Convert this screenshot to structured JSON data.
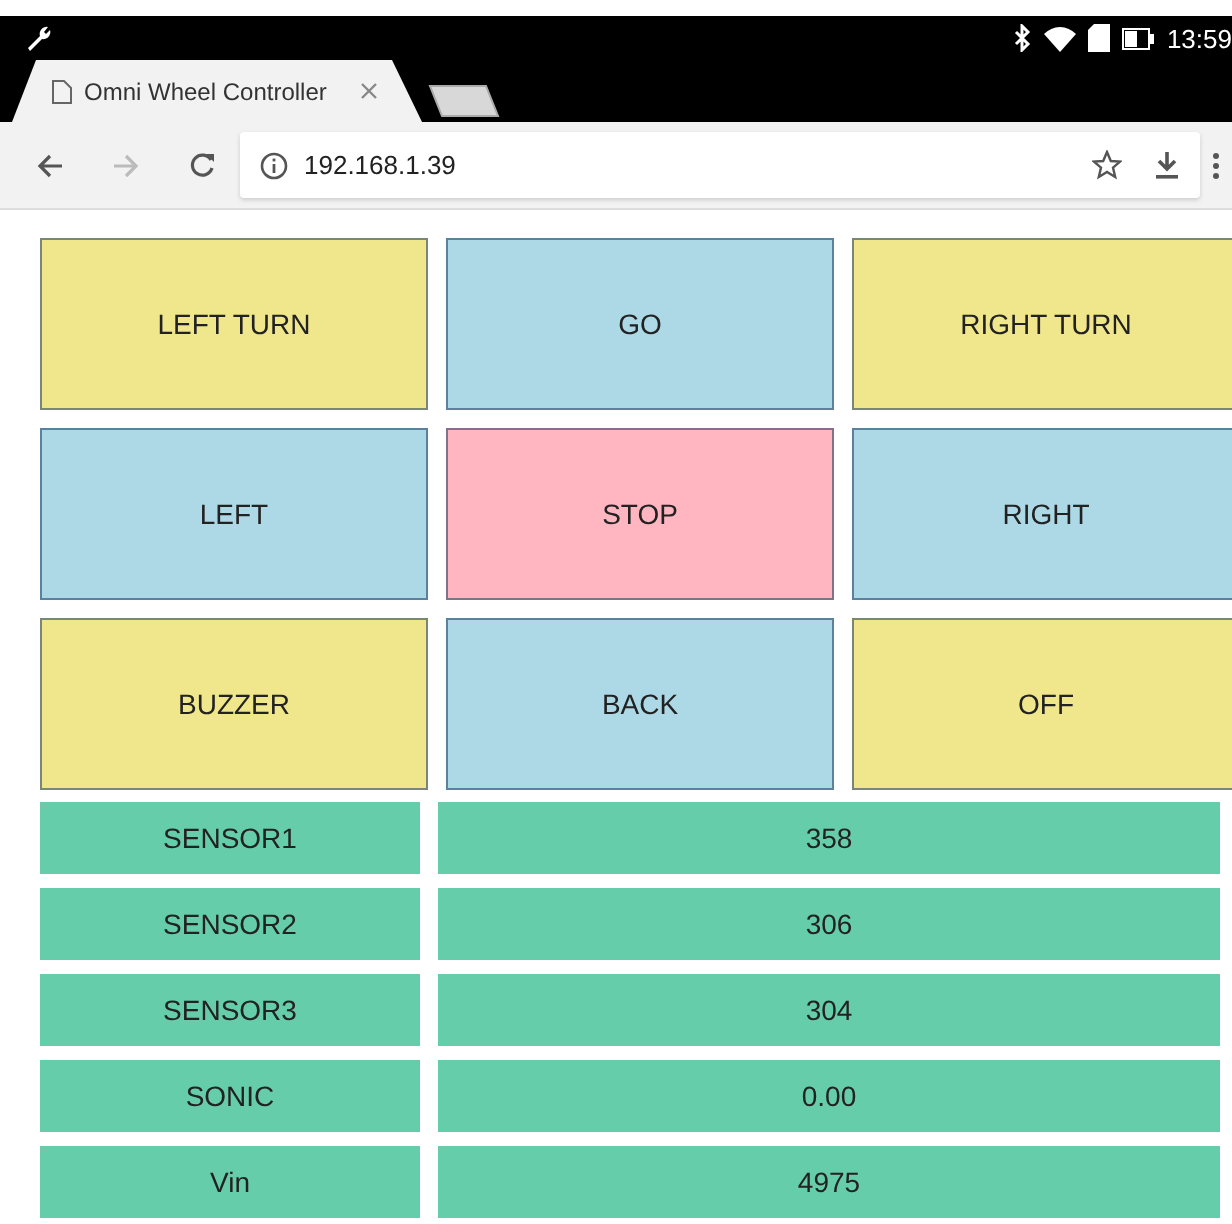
{
  "status_bar": {
    "time": "13:59"
  },
  "tab": {
    "title": "Omni Wheel Controller",
    "selected": true
  },
  "toolbar": {
    "url": "192.168.1.39",
    "forward_disabled": true
  },
  "buttons": [
    {
      "label": "LEFT TURN",
      "color": "#f0e68c"
    },
    {
      "label": "GO",
      "color": "#add8e6"
    },
    {
      "label": "RIGHT TURN",
      "color": "#f0e68c"
    },
    {
      "label": "LEFT",
      "color": "#add8e6"
    },
    {
      "label": "STOP",
      "color": "#ffb6c1"
    },
    {
      "label": "RIGHT",
      "color": "#add8e6"
    },
    {
      "label": "BUZZER",
      "color": "#f0e68c"
    },
    {
      "label": "BACK",
      "color": "#add8e6"
    },
    {
      "label": "OFF",
      "color": "#f0e68c"
    }
  ],
  "sensors": [
    {
      "label": "SENSOR1",
      "value": "358"
    },
    {
      "label": "SENSOR2",
      "value": "306"
    },
    {
      "label": "SENSOR3",
      "value": "304"
    },
    {
      "label": "SONIC",
      "value": "0.00"
    },
    {
      "label": "Vin",
      "value": "4975"
    }
  ]
}
